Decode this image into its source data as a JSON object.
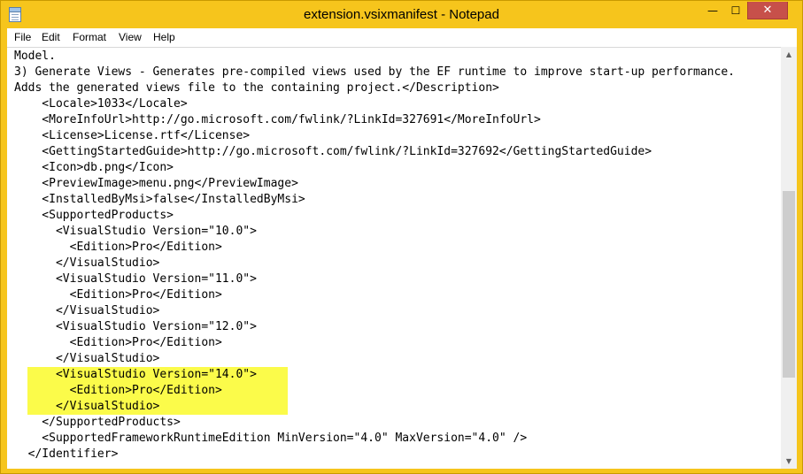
{
  "window": {
    "title": "extension.vsixmanifest - Notepad",
    "controls": {
      "minimize": "—",
      "maximize": "☐",
      "close": "✕"
    }
  },
  "menubar": {
    "items": [
      "File",
      "Edit",
      "Format",
      "View",
      "Help"
    ]
  },
  "editor": {
    "lines": [
      "Model.",
      "3) Generate Views - Generates pre-compiled views used by the EF runtime to improve start-up performance.",
      "Adds the generated views file to the containing project.</Description>",
      "    <Locale>1033</Locale>",
      "    <MoreInfoUrl>http://go.microsoft.com/fwlink/?LinkId=327691</MoreInfoUrl>",
      "    <License>License.rtf</License>",
      "    <GettingStartedGuide>http://go.microsoft.com/fwlink/?LinkId=327692</GettingStartedGuide>",
      "    <Icon>db.png</Icon>",
      "    <PreviewImage>menu.png</PreviewImage>",
      "    <InstalledByMsi>false</InstalledByMsi>",
      "    <SupportedProducts>",
      "      <VisualStudio Version=\"10.0\">",
      "        <Edition>Pro</Edition>",
      "      </VisualStudio>",
      "      <VisualStudio Version=\"11.0\">",
      "        <Edition>Pro</Edition>",
      "      </VisualStudio>",
      "      <VisualStudio Version=\"12.0\">",
      "        <Edition>Pro</Edition>",
      "      </VisualStudio>",
      "      <VisualStudio Version=\"14.0\">",
      "        <Edition>Pro</Edition>",
      "      </VisualStudio>",
      "    </SupportedProducts>",
      "    <SupportedFrameworkRuntimeEdition MinVersion=\"4.0\" MaxVersion=\"4.0\" />",
      "  </Identifier>"
    ],
    "highlight_color": "#fbfb4a"
  },
  "scrollbar": {
    "up_arrow": "▲",
    "down_arrow": "▼"
  },
  "colors": {
    "frame": "#f6c51c",
    "close_button": "#c7504a"
  }
}
